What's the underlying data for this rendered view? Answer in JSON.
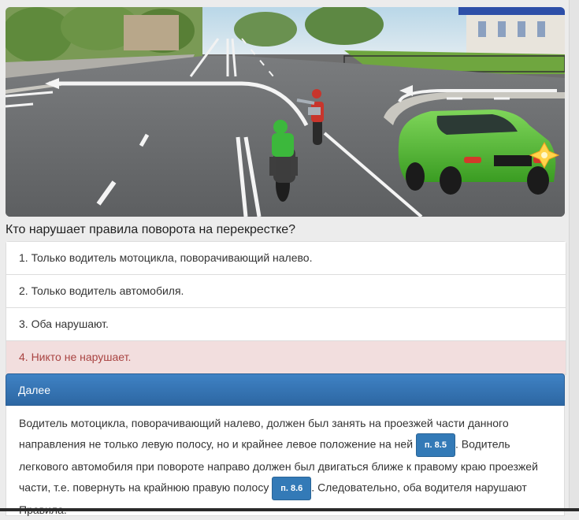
{
  "question": {
    "image_alt": "intersection-scene",
    "text": "Кто нарушает правила поворота на перекрестке?"
  },
  "answers": [
    {
      "label": "1. Только водитель мотоцикла, поворачивающий налево.",
      "state": "normal"
    },
    {
      "label": "2. Только водитель автомобиля.",
      "state": "normal"
    },
    {
      "label": "3. Оба нарушают.",
      "state": "normal"
    },
    {
      "label": "4. Никто не нарушает.",
      "state": "wrong"
    }
  ],
  "next_button": {
    "label": "Далее"
  },
  "explanation": {
    "part1": "Водитель мотоцикла, поворачивающий налево, должен был занять на проезжей части данного направления не только левую полосу, но и крайнее левое положение на ней ",
    "ref1": "п. 8.5",
    "part2": ". Водитель легкового автомобиля при повороте направо должен был двигаться ближе к правому краю проезжей части, т.е. повернуть на крайнюю правую полосу ",
    "ref2": "п. 8.6",
    "part3": ". Следовательно, оба водителя нарушают Правила."
  },
  "colors": {
    "accent": "#337ab7",
    "wrong_bg": "#f2dede",
    "wrong_text": "#a94442",
    "car": "#5fc43a"
  },
  "icons": {
    "star": "four-point-star-icon"
  }
}
